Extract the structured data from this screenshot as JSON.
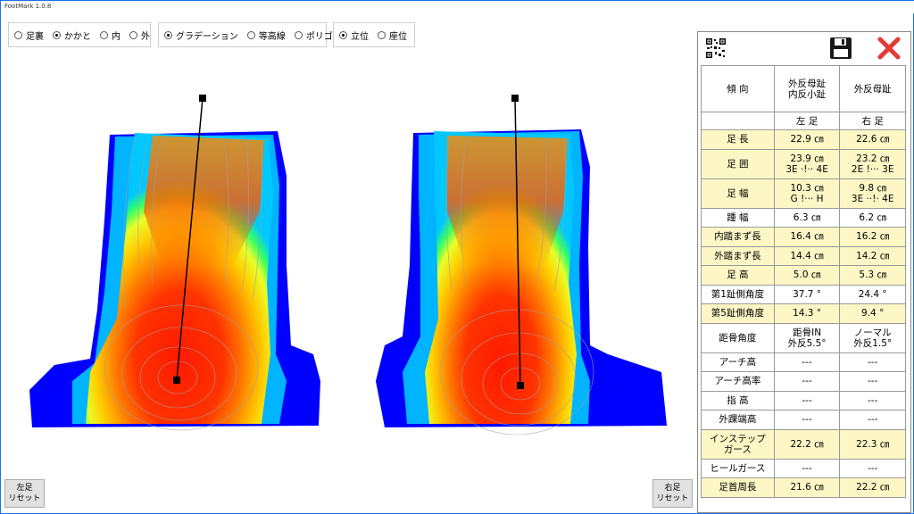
{
  "app": {
    "title": "FootMark 1.0.8"
  },
  "view_options": {
    "options": [
      {
        "label": "足裏",
        "selected": false
      },
      {
        "label": "かかと",
        "selected": true
      },
      {
        "label": "内",
        "selected": false
      },
      {
        "label": "外",
        "selected": false
      }
    ]
  },
  "render_options": {
    "options": [
      {
        "label": "グラデーション",
        "selected": true
      },
      {
        "label": "等高線",
        "selected": false
      },
      {
        "label": "ポリゴン",
        "selected": false
      }
    ]
  },
  "posture_options": {
    "options": [
      {
        "label": "立位",
        "selected": true
      },
      {
        "label": "座位",
        "selected": false
      }
    ]
  },
  "buttons": {
    "left_reset_line1": "左足",
    "left_reset_line2": "リセット",
    "right_reset_line1": "右足",
    "right_reset_line2": "リセット"
  },
  "table": {
    "header": {
      "label": "傾 向",
      "left_line1": "外反母趾",
      "left_line2": "内反小趾",
      "right_line1": "外反母趾",
      "right_line2": ""
    },
    "side_row": {
      "label": "",
      "left": "左 足",
      "right": "右 足"
    },
    "rows": [
      {
        "label1": "足 長",
        "label2": "",
        "l1": "22.9 ㎝",
        "l2": "",
        "r1": "22.6 ㎝",
        "r2": "",
        "highlight": true
      },
      {
        "label1": "足 囲",
        "label2": "",
        "l1": "23.9 ㎝",
        "l2": "3E ·!·· 4E",
        "r1": "23.2 ㎝",
        "r2": "2E !··· 3E",
        "highlight": true
      },
      {
        "label1": "足 幅",
        "label2": "",
        "l1": "10.3 ㎝",
        "l2": "G !··· H",
        "r1": "9.8 ㎝",
        "r2": "3E ··!· 4E",
        "highlight": true
      },
      {
        "label1": "踵 幅",
        "label2": "",
        "l1": "6.3 ㎝",
        "l2": "",
        "r1": "6.2 ㎝",
        "r2": "",
        "highlight": false
      },
      {
        "label1": "内踏まず長",
        "label2": "",
        "l1": "16.4 ㎝",
        "l2": "",
        "r1": "16.2 ㎝",
        "r2": "",
        "highlight": true
      },
      {
        "label1": "外踏まず長",
        "label2": "",
        "l1": "14.4 ㎝",
        "l2": "",
        "r1": "14.2 ㎝",
        "r2": "",
        "highlight": true
      },
      {
        "label1": "足 高",
        "label2": "",
        "l1": "5.0 ㎝",
        "l2": "",
        "r1": "5.3 ㎝",
        "r2": "",
        "highlight": true
      },
      {
        "label1": "第1趾側角度",
        "label2": "",
        "l1": "37.7 °",
        "l2": "",
        "r1": "24.4 °",
        "r2": "",
        "highlight": false
      },
      {
        "label1": "第5趾側角度",
        "label2": "",
        "l1": "14.3 °",
        "l2": "",
        "r1": "9.4 °",
        "r2": "",
        "highlight": true
      },
      {
        "label1": "距骨角度",
        "label2": "",
        "l1": "距骨IN",
        "l2": "外反5.5°",
        "r1": "ノーマル",
        "r2": "外反1.5°",
        "highlight": false
      },
      {
        "label1": "アーチ高",
        "label2": "",
        "l1": "---",
        "l2": "",
        "r1": "---",
        "r2": "",
        "highlight": false
      },
      {
        "label1": "アーチ高率",
        "label2": "",
        "l1": "---",
        "l2": "",
        "r1": "---",
        "r2": "",
        "highlight": false
      },
      {
        "label1": "指 高",
        "label2": "",
        "l1": "---",
        "l2": "",
        "r1": "---",
        "r2": "",
        "highlight": false
      },
      {
        "label1": "外踝端高",
        "label2": "",
        "l1": "---",
        "l2": "",
        "r1": "---",
        "r2": "",
        "highlight": false
      },
      {
        "label1": "インステップ",
        "label2": "ガース",
        "l1": "22.2 ㎝",
        "l2": "",
        "r1": "22.3 ㎝",
        "r2": "",
        "highlight": true
      },
      {
        "label1": "ヒールガース",
        "label2": "",
        "l1": "---",
        "l2": "",
        "r1": "---",
        "r2": "",
        "highlight": false
      },
      {
        "label1": "足首周長",
        "label2": "",
        "l1": "21.6 ㎝",
        "l2": "",
        "r1": "22.2 ㎝",
        "r2": "",
        "highlight": true
      }
    ]
  },
  "colors": {
    "highlight_row": "#fdf7c5",
    "close_red": "#e53935",
    "heat_low": "#0000ff",
    "heat_high": "#ff2200"
  },
  "icons": {
    "save": "floppy-disk-icon",
    "close": "close-x-icon",
    "qr": "qr-code-icon"
  }
}
